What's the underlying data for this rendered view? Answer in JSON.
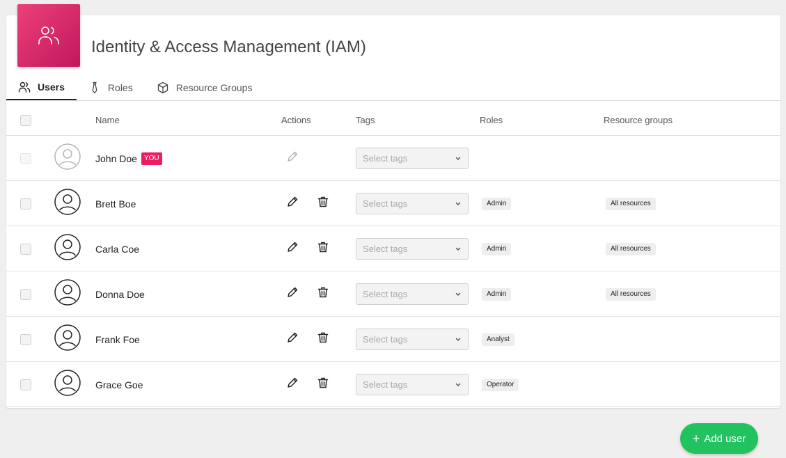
{
  "header": {
    "title": "Identity & Access Management (IAM)",
    "app_icon": "users-icon",
    "accent_color": "#e91e63"
  },
  "tabs": [
    {
      "label": "Users",
      "icon": "users-icon",
      "active": true
    },
    {
      "label": "Roles",
      "icon": "tie-icon",
      "active": false
    },
    {
      "label": "Resource Groups",
      "icon": "cube-icon",
      "active": false
    }
  ],
  "table": {
    "columns": {
      "name": "Name",
      "actions": "Actions",
      "tags": "Tags",
      "roles": "Roles",
      "resource_groups": "Resource groups"
    },
    "tags_placeholder": "Select tags",
    "rows": [
      {
        "name": "John Doe",
        "badge": "YOU",
        "role": "",
        "resource_group": "",
        "current_user": true
      },
      {
        "name": "Brett Boe",
        "badge": "",
        "role": "Admin",
        "resource_group": "All resources",
        "current_user": false
      },
      {
        "name": "Carla Coe",
        "badge": "",
        "role": "Admin",
        "resource_group": "All resources",
        "current_user": false
      },
      {
        "name": "Donna Doe",
        "badge": "",
        "role": "Admin",
        "resource_group": "All resources",
        "current_user": false
      },
      {
        "name": "Frank Foe",
        "badge": "",
        "role": "Analyst",
        "resource_group": "",
        "current_user": false
      },
      {
        "name": "Grace Goe",
        "badge": "",
        "role": "Operator",
        "resource_group": "",
        "current_user": false
      }
    ]
  },
  "fab": {
    "label": "Add user",
    "icon": "plus-icon",
    "color": "#22c35e"
  }
}
